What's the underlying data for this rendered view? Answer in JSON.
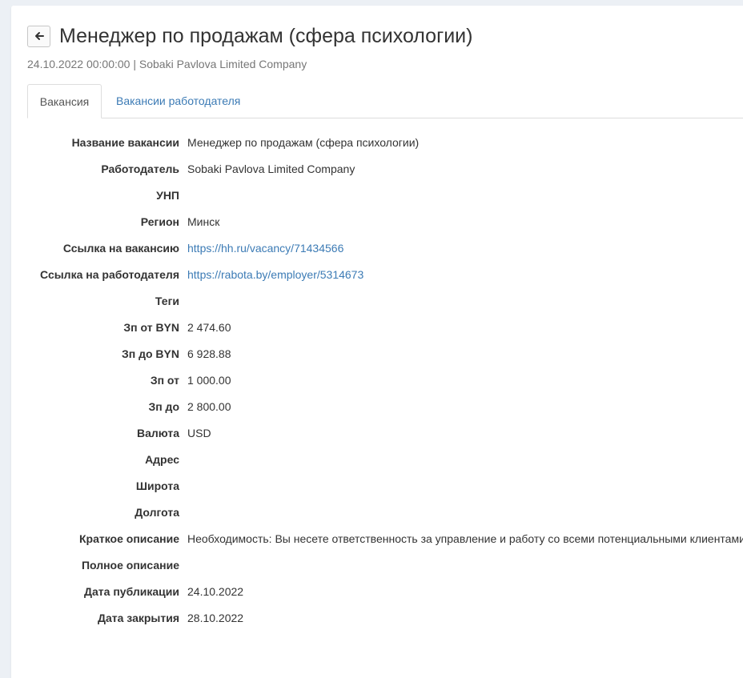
{
  "header": {
    "back_icon": "arrow-left-icon",
    "title": "Менеджер по продажам (сфера психологии)",
    "subtitle": "24.10.2022 00:00:00 | Sobaki Pavlova Limited Company"
  },
  "tabs": [
    {
      "label": "Вакансия",
      "active": true
    },
    {
      "label": "Вакансии работодателя",
      "active": false
    }
  ],
  "fields": [
    {
      "label": "Название вакансии",
      "value": "Менеджер по продажам (сфера психологии)"
    },
    {
      "label": "Работодатель",
      "value": "Sobaki Pavlova Limited Company"
    },
    {
      "label": "УНП",
      "value": ""
    },
    {
      "label": "Регион",
      "value": "Минск"
    },
    {
      "label": "Ссылка на вакансию",
      "value": "https://hh.ru/vacancy/71434566"
    },
    {
      "label": "Ссылка на работодателя",
      "value": "https://rabota.by/employer/5314673"
    },
    {
      "label": "Теги",
      "value": ""
    },
    {
      "label": "Зп от BYN",
      "value": "2 474.60"
    },
    {
      "label": "Зп до BYN",
      "value": "6 928.88"
    },
    {
      "label": "Зп от",
      "value": "1 000.00"
    },
    {
      "label": "Зп до",
      "value": "2 800.00"
    },
    {
      "label": "Валюта",
      "value": "USD"
    },
    {
      "label": "Адрес",
      "value": ""
    },
    {
      "label": "Широта",
      "value": ""
    },
    {
      "label": "Долгота",
      "value": ""
    },
    {
      "label": "Краткое описание",
      "value": "Необходимость: Вы несете ответственность за управление и работу со всеми потенциальными клиентами"
    },
    {
      "label": "Полное описание",
      "value": ""
    },
    {
      "label": "Дата публикации",
      "value": "24.10.2022"
    },
    {
      "label": "Дата закрытия",
      "value": "28.10.2022"
    }
  ],
  "colors": {
    "link": "#3c7bb5",
    "background": "#ecf0f5"
  }
}
